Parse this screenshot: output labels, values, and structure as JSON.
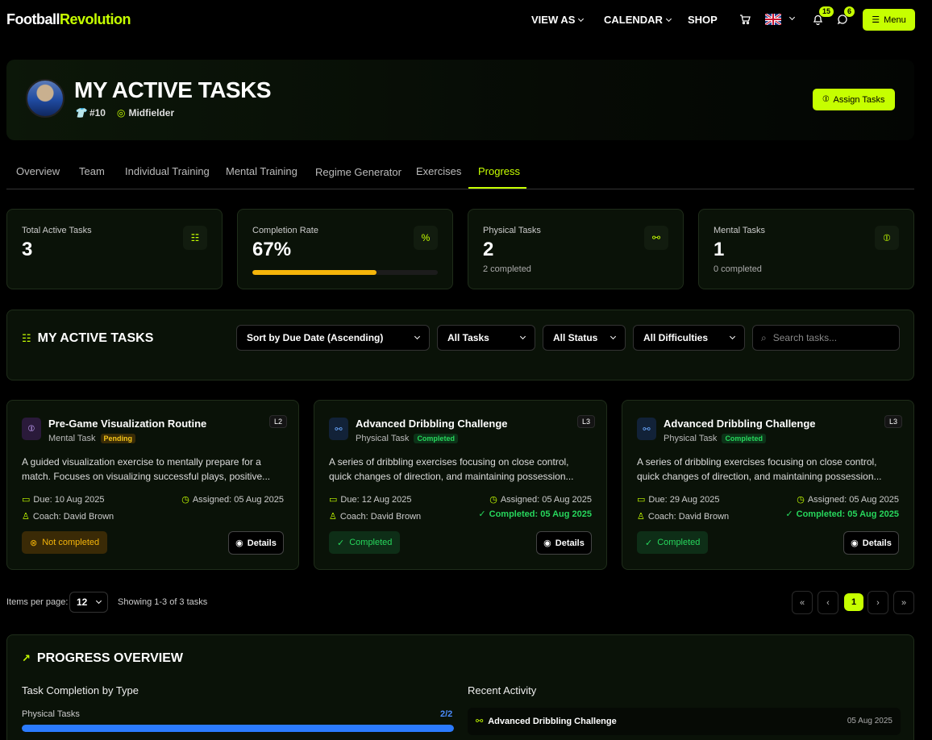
{
  "header": {
    "logo_part1": "Football",
    "logo_part2": "Revolution",
    "nav": [
      "VIEW AS",
      "CALENDAR",
      "SHOP"
    ],
    "notifications_count": "15",
    "messages_count": "6",
    "menu_label": "Menu",
    "language_flag": "uk-flag-icon"
  },
  "hero": {
    "title": "MY ACTIVE TASKS",
    "jersey_number": "#10",
    "position": "Midfielder",
    "assign_label": "Assign Tasks"
  },
  "tabs": [
    "Overview",
    "Team",
    "Individual Training",
    "Mental Training",
    "Regime Generator",
    "Exercises",
    "Progress"
  ],
  "active_tab": "Progress",
  "stats": {
    "total": {
      "label": "Total Active Tasks",
      "value": "3"
    },
    "completion": {
      "label": "Completion Rate",
      "value": "67%",
      "progress": 0.67
    },
    "physical": {
      "label": "Physical Tasks",
      "value": "2",
      "sub": "2 completed"
    },
    "mental": {
      "label": "Mental Tasks",
      "value": "1",
      "sub": "0 completed"
    }
  },
  "filters": {
    "title": "MY ACTIVE TASKS",
    "sort": "Sort by Due Date (Ascending)",
    "type": "All Tasks",
    "status": "All Status",
    "difficulty": "All Difficulties",
    "search_placeholder": "Search tasks..."
  },
  "tasks": [
    {
      "title": "Pre-Game Visualization Routine",
      "type": "Mental Task",
      "status_pill": "Pending",
      "level": "L2",
      "description": "A guided visualization exercise to mentally prepare for a match. Focuses on visualizing successful plays, positive...",
      "due": "Due: 10 Aug 2025",
      "assigned": "Assigned: 05 Aug 2025",
      "coach": "Coach: David Brown",
      "completed_date": "",
      "status_button": "Not completed",
      "details_label": "Details"
    },
    {
      "title": "Advanced Dribbling Challenge",
      "type": "Physical Task",
      "status_pill": "Completed",
      "level": "L3",
      "description": "A series of dribbling exercises focusing on close control, quick changes of direction, and maintaining possession...",
      "due": "Due: 12 Aug 2025",
      "assigned": "Assigned: 05 Aug 2025",
      "coach": "Coach: David Brown",
      "completed_date": "Completed: 05 Aug 2025",
      "status_button": "Completed",
      "details_label": "Details"
    },
    {
      "title": "Advanced Dribbling Challenge",
      "type": "Physical Task",
      "status_pill": "Completed",
      "level": "L3",
      "description": "A series of dribbling exercises focusing on close control, quick changes of direction, and maintaining possession...",
      "due": "Due: 29 Aug 2025",
      "assigned": "Assigned: 05 Aug 2025",
      "coach": "Coach: David Brown",
      "completed_date": "Completed: 05 Aug 2025",
      "status_button": "Completed",
      "details_label": "Details"
    }
  ],
  "pagination": {
    "items_label": "Items per page:",
    "items_per_page": "12",
    "showing": "Showing 1-3 of 3 tasks",
    "current_page": "1"
  },
  "progress_overview": {
    "title": "PROGRESS OVERVIEW",
    "by_type_title": "Task Completion by Type",
    "physical_label": "Physical Tasks",
    "physical_value": "2/2",
    "physical_progress": 1.0,
    "recent_title": "Recent Activity",
    "recent_item": "Advanced Dribbling Challenge",
    "recent_date": "05 Aug 2025"
  },
  "colors": {
    "accent": "#c6ff00",
    "progress_bar": "#f5b50a",
    "success": "#27d65c",
    "blue": "#2b7bff"
  }
}
